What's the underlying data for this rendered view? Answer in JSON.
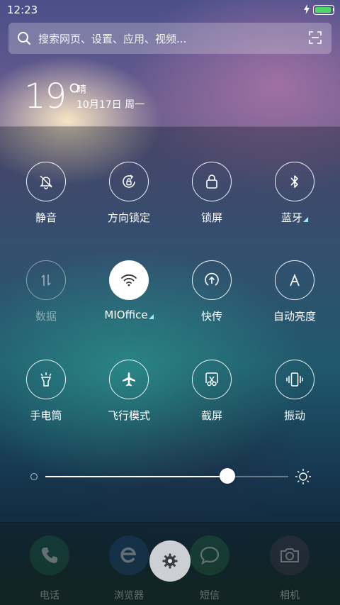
{
  "status_bar": {
    "time": "12:23",
    "battery_color": "#4cd964"
  },
  "search": {
    "placeholder": "搜索网页、设置、应用、视频..."
  },
  "weather": {
    "temperature": "19°",
    "condition": "晴",
    "date": "10月17日 周一"
  },
  "toggles": [
    {
      "label": "静音",
      "icon": "bell-off-icon",
      "state": "off"
    },
    {
      "label": "方向锁定",
      "icon": "rotation-lock-icon",
      "state": "off"
    },
    {
      "label": "锁屏",
      "icon": "lock-icon",
      "state": "off"
    },
    {
      "label": "蓝牙",
      "icon": "bluetooth-icon",
      "state": "off",
      "has_more": true
    },
    {
      "label": "数据",
      "icon": "mobile-data-icon",
      "state": "disabled"
    },
    {
      "label": "MIOffice",
      "icon": "wifi-icon",
      "state": "on",
      "has_more": true
    },
    {
      "label": "快传",
      "icon": "quick-transfer-icon",
      "state": "off"
    },
    {
      "label": "自动亮度",
      "icon": "auto-brightness-icon",
      "state": "off"
    },
    {
      "label": "手电筒",
      "icon": "flashlight-icon",
      "state": "off"
    },
    {
      "label": "飞行模式",
      "icon": "airplane-icon",
      "state": "off"
    },
    {
      "label": "截屏",
      "icon": "screenshot-icon",
      "state": "off"
    },
    {
      "label": "振动",
      "icon": "vibrate-icon",
      "state": "off"
    }
  ],
  "brightness": {
    "level": 0.75
  },
  "dock": {
    "apps": [
      {
        "label": "电话",
        "icon": "phone-icon"
      },
      {
        "label": "浏览器",
        "icon": "browser-icon"
      },
      {
        "label": "短信",
        "icon": "message-icon"
      },
      {
        "label": "相机",
        "icon": "camera-icon"
      }
    ],
    "settings_icon": "gear-icon"
  },
  "colors": {
    "accent_triangle": "#9fe7f7",
    "active_toggle_bg": "#ffffff"
  }
}
